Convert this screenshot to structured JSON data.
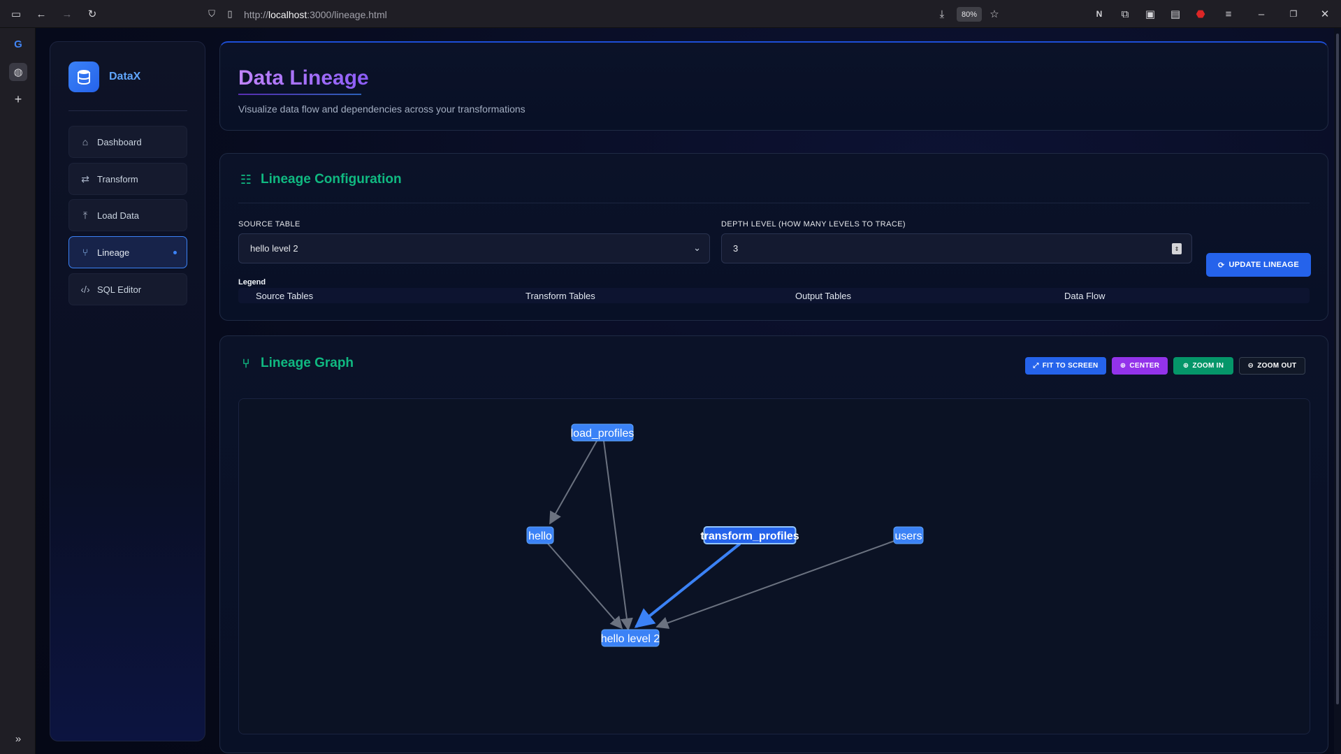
{
  "browser": {
    "url_prefix": "http://",
    "url_host": "localhost",
    "url_rest": ":3000/lineage.html",
    "zoom": "80%"
  },
  "sidebar": {
    "brand": "DataX",
    "items": [
      {
        "label": "Dashboard",
        "icon": "home-icon",
        "active": false
      },
      {
        "label": "Transform",
        "icon": "swap-icon",
        "active": false
      },
      {
        "label": "Load Data",
        "icon": "upload-icon",
        "active": false
      },
      {
        "label": "Lineage",
        "icon": "graph-icon",
        "active": true
      },
      {
        "label": "SQL Editor",
        "icon": "code-icon",
        "active": false
      }
    ]
  },
  "header": {
    "title": "Data Lineage",
    "subtitle": "Visualize data flow and dependencies across your transformations"
  },
  "config": {
    "heading": "Lineage Configuration",
    "source_label": "SOURCE TABLE",
    "source_value": "hello level 2",
    "depth_label": "DEPTH LEVEL (HOW MANY LEVELS TO TRACE)",
    "depth_value": "3",
    "update_button": "UPDATE LINEAGE",
    "legend_title": "Legend",
    "legend_items": [
      "Source Tables",
      "Transform Tables",
      "Output Tables",
      "Data Flow"
    ]
  },
  "graph": {
    "heading": "Lineage Graph",
    "buttons": {
      "fit": "FIT TO SCREEN",
      "center": "CENTER",
      "zoom_in": "ZOOM IN",
      "zoom_out": "ZOOM OUT"
    },
    "colors": {
      "node": "#3b82f6",
      "node_highlight": "#2563eb",
      "edge": "#6b7280",
      "edge_highlight": "#3b82f6",
      "accent_green": "#10b981",
      "accent_purple": "#a855f7"
    },
    "nodes": [
      {
        "id": "load_profiles",
        "label": "load_profiles"
      },
      {
        "id": "hello",
        "label": "hello"
      },
      {
        "id": "transform_profiles",
        "label": "transform_profiles"
      },
      {
        "id": "users",
        "label": "users"
      },
      {
        "id": "hello_level_2",
        "label": "hello level 2"
      }
    ],
    "edges": [
      {
        "from": "load_profiles",
        "to": "hello"
      },
      {
        "from": "load_profiles",
        "to": "hello_level_2"
      },
      {
        "from": "hello",
        "to": "hello_level_2"
      },
      {
        "from": "transform_profiles",
        "to": "hello_level_2",
        "highlight": true
      },
      {
        "from": "users",
        "to": "hello_level_2"
      }
    ]
  }
}
